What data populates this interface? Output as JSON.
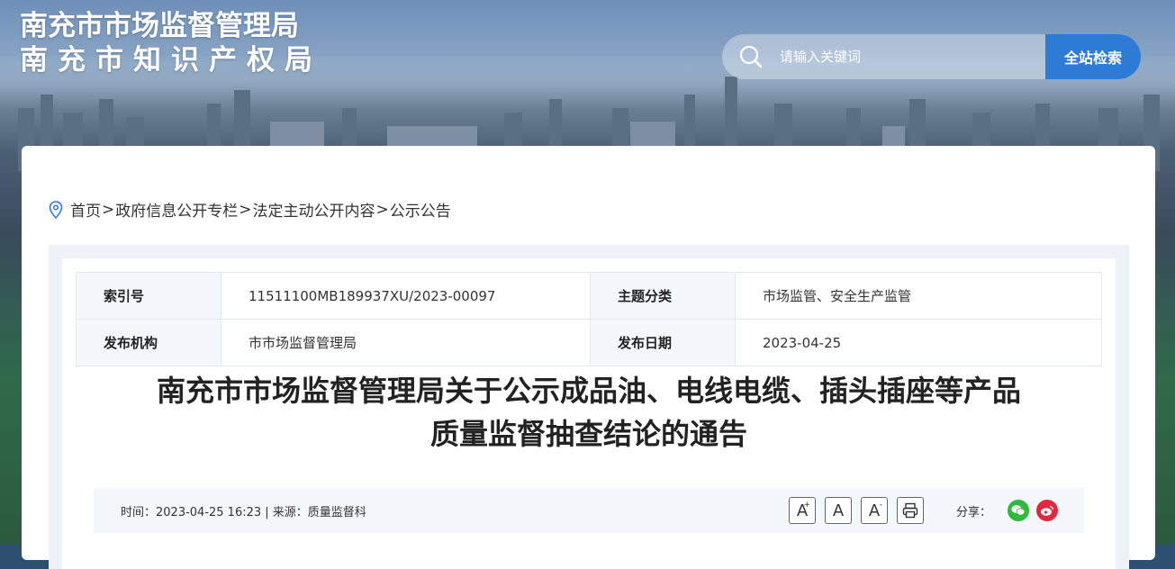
{
  "header": {
    "title_line1": "南充市市场监督管理局",
    "title_line2": "南充市知识产权局"
  },
  "search": {
    "placeholder": "请输入关键词",
    "button_label": "全站检索"
  },
  "breadcrumb": [
    "首页",
    "政府信息公开专栏",
    "法定主动公开内容",
    "公示公告"
  ],
  "breadcrumb_sep": ">",
  "meta": {
    "index_label": "索引号",
    "index_value": "11511100MB189937XU/2023-00097",
    "topic_label": "主题分类",
    "topic_value": "市场监管、安全生产监管",
    "publisher_label": "发布机构",
    "publisher_value": "市市场监督管理局",
    "date_label": "发布日期",
    "date_value": "2023-04-25"
  },
  "document": {
    "title_line1": "南充市市场监督管理局关于公示成品油、电线电缆、插头插座等产品",
    "title_line2": "质量监督抽查结论的通告",
    "info": "时间：2023-04-25 16:23 | 来源：质量监督科"
  },
  "tools": {
    "font_increase": "A",
    "font_normal": "A",
    "font_decrease": "A",
    "plus_sign": "+",
    "minus_sign": "-"
  },
  "share": {
    "label": "分享："
  },
  "colors": {
    "search_button": "#2d7bd6",
    "wechat": "#2dbb38",
    "weibo": "#e0293f"
  }
}
